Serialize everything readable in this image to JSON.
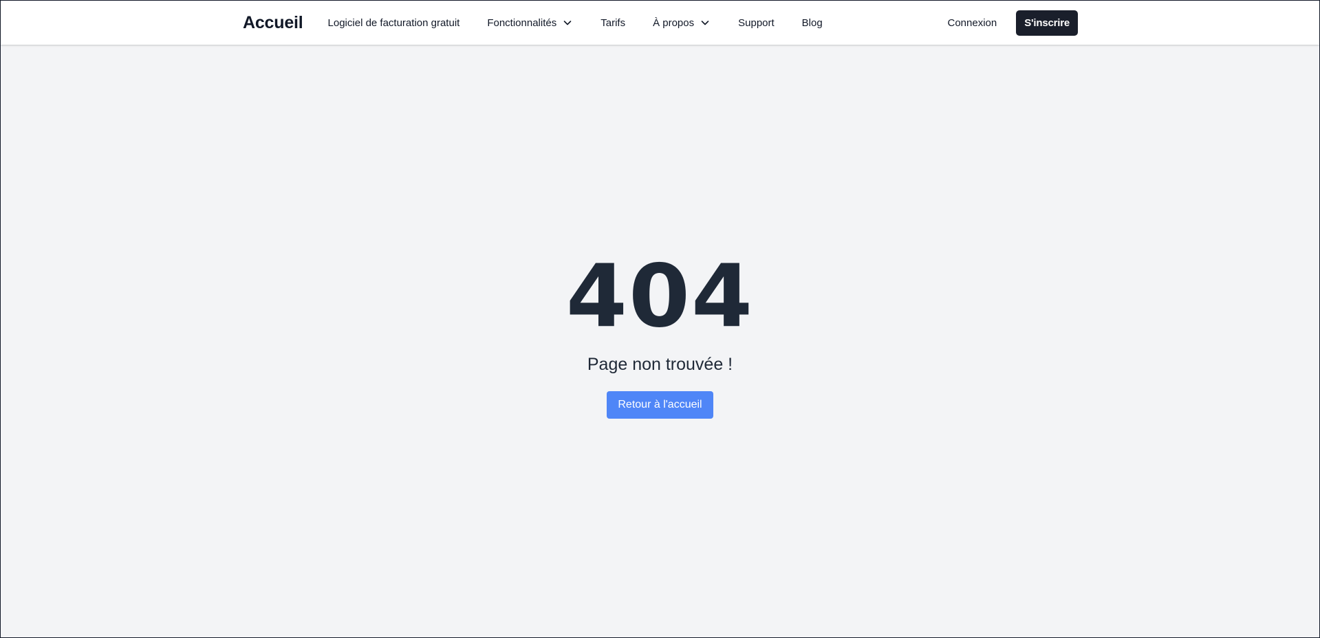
{
  "navbar": {
    "brand": "Accueil",
    "links": [
      {
        "label": "Logiciel de facturation gratuit",
        "has_dropdown": false
      },
      {
        "label": "Fonctionnalités",
        "has_dropdown": true
      },
      {
        "label": "Tarifs",
        "has_dropdown": false
      },
      {
        "label": "À propos",
        "has_dropdown": true
      },
      {
        "label": "Support",
        "has_dropdown": false
      },
      {
        "label": "Blog",
        "has_dropdown": false
      }
    ],
    "login_label": "Connexion",
    "signup_label": "S'inscrire"
  },
  "error": {
    "code": "404",
    "message": "Page non trouvée !",
    "home_button_label": "Retour à l'accueil"
  },
  "icons": {
    "dropdown": "chevron-down-icon"
  },
  "colors": {
    "background": "#f3f4f6",
    "text": "#1f2937",
    "primary_button": "#4f86f7",
    "dark_button": "#1a1f2b"
  }
}
